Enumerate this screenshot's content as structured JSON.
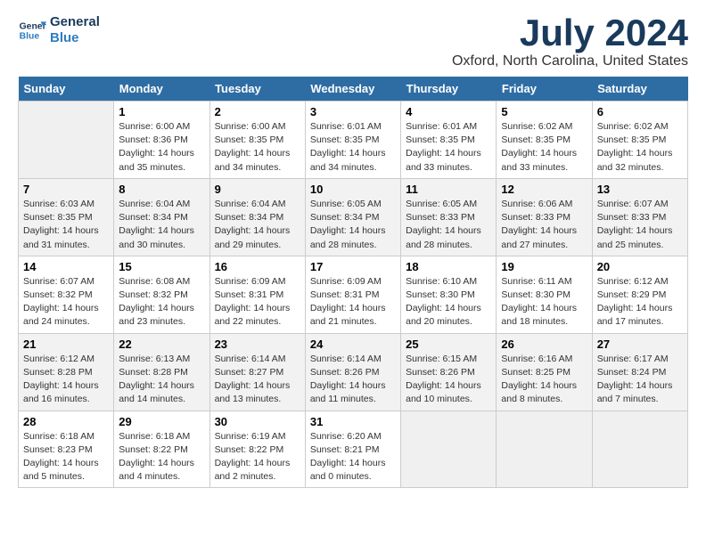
{
  "header": {
    "logo_line1": "General",
    "logo_line2": "Blue",
    "title": "July 2024",
    "location": "Oxford, North Carolina, United States"
  },
  "columns": [
    "Sunday",
    "Monday",
    "Tuesday",
    "Wednesday",
    "Thursday",
    "Friday",
    "Saturday"
  ],
  "weeks": [
    [
      {
        "day": "",
        "info": ""
      },
      {
        "day": "1",
        "info": "Sunrise: 6:00 AM\nSunset: 8:36 PM\nDaylight: 14 hours\nand 35 minutes."
      },
      {
        "day": "2",
        "info": "Sunrise: 6:00 AM\nSunset: 8:35 PM\nDaylight: 14 hours\nand 34 minutes."
      },
      {
        "day": "3",
        "info": "Sunrise: 6:01 AM\nSunset: 8:35 PM\nDaylight: 14 hours\nand 34 minutes."
      },
      {
        "day": "4",
        "info": "Sunrise: 6:01 AM\nSunset: 8:35 PM\nDaylight: 14 hours\nand 33 minutes."
      },
      {
        "day": "5",
        "info": "Sunrise: 6:02 AM\nSunset: 8:35 PM\nDaylight: 14 hours\nand 33 minutes."
      },
      {
        "day": "6",
        "info": "Sunrise: 6:02 AM\nSunset: 8:35 PM\nDaylight: 14 hours\nand 32 minutes."
      }
    ],
    [
      {
        "day": "7",
        "info": "Sunrise: 6:03 AM\nSunset: 8:35 PM\nDaylight: 14 hours\nand 31 minutes."
      },
      {
        "day": "8",
        "info": "Sunrise: 6:04 AM\nSunset: 8:34 PM\nDaylight: 14 hours\nand 30 minutes."
      },
      {
        "day": "9",
        "info": "Sunrise: 6:04 AM\nSunset: 8:34 PM\nDaylight: 14 hours\nand 29 minutes."
      },
      {
        "day": "10",
        "info": "Sunrise: 6:05 AM\nSunset: 8:34 PM\nDaylight: 14 hours\nand 28 minutes."
      },
      {
        "day": "11",
        "info": "Sunrise: 6:05 AM\nSunset: 8:33 PM\nDaylight: 14 hours\nand 28 minutes."
      },
      {
        "day": "12",
        "info": "Sunrise: 6:06 AM\nSunset: 8:33 PM\nDaylight: 14 hours\nand 27 minutes."
      },
      {
        "day": "13",
        "info": "Sunrise: 6:07 AM\nSunset: 8:33 PM\nDaylight: 14 hours\nand 25 minutes."
      }
    ],
    [
      {
        "day": "14",
        "info": "Sunrise: 6:07 AM\nSunset: 8:32 PM\nDaylight: 14 hours\nand 24 minutes."
      },
      {
        "day": "15",
        "info": "Sunrise: 6:08 AM\nSunset: 8:32 PM\nDaylight: 14 hours\nand 23 minutes."
      },
      {
        "day": "16",
        "info": "Sunrise: 6:09 AM\nSunset: 8:31 PM\nDaylight: 14 hours\nand 22 minutes."
      },
      {
        "day": "17",
        "info": "Sunrise: 6:09 AM\nSunset: 8:31 PM\nDaylight: 14 hours\nand 21 minutes."
      },
      {
        "day": "18",
        "info": "Sunrise: 6:10 AM\nSunset: 8:30 PM\nDaylight: 14 hours\nand 20 minutes."
      },
      {
        "day": "19",
        "info": "Sunrise: 6:11 AM\nSunset: 8:30 PM\nDaylight: 14 hours\nand 18 minutes."
      },
      {
        "day": "20",
        "info": "Sunrise: 6:12 AM\nSunset: 8:29 PM\nDaylight: 14 hours\nand 17 minutes."
      }
    ],
    [
      {
        "day": "21",
        "info": "Sunrise: 6:12 AM\nSunset: 8:28 PM\nDaylight: 14 hours\nand 16 minutes."
      },
      {
        "day": "22",
        "info": "Sunrise: 6:13 AM\nSunset: 8:28 PM\nDaylight: 14 hours\nand 14 minutes."
      },
      {
        "day": "23",
        "info": "Sunrise: 6:14 AM\nSunset: 8:27 PM\nDaylight: 14 hours\nand 13 minutes."
      },
      {
        "day": "24",
        "info": "Sunrise: 6:14 AM\nSunset: 8:26 PM\nDaylight: 14 hours\nand 11 minutes."
      },
      {
        "day": "25",
        "info": "Sunrise: 6:15 AM\nSunset: 8:26 PM\nDaylight: 14 hours\nand 10 minutes."
      },
      {
        "day": "26",
        "info": "Sunrise: 6:16 AM\nSunset: 8:25 PM\nDaylight: 14 hours\nand 8 minutes."
      },
      {
        "day": "27",
        "info": "Sunrise: 6:17 AM\nSunset: 8:24 PM\nDaylight: 14 hours\nand 7 minutes."
      }
    ],
    [
      {
        "day": "28",
        "info": "Sunrise: 6:18 AM\nSunset: 8:23 PM\nDaylight: 14 hours\nand 5 minutes."
      },
      {
        "day": "29",
        "info": "Sunrise: 6:18 AM\nSunset: 8:22 PM\nDaylight: 14 hours\nand 4 minutes."
      },
      {
        "day": "30",
        "info": "Sunrise: 6:19 AM\nSunset: 8:22 PM\nDaylight: 14 hours\nand 2 minutes."
      },
      {
        "day": "31",
        "info": "Sunrise: 6:20 AM\nSunset: 8:21 PM\nDaylight: 14 hours\nand 0 minutes."
      },
      {
        "day": "",
        "info": ""
      },
      {
        "day": "",
        "info": ""
      },
      {
        "day": "",
        "info": ""
      }
    ]
  ]
}
